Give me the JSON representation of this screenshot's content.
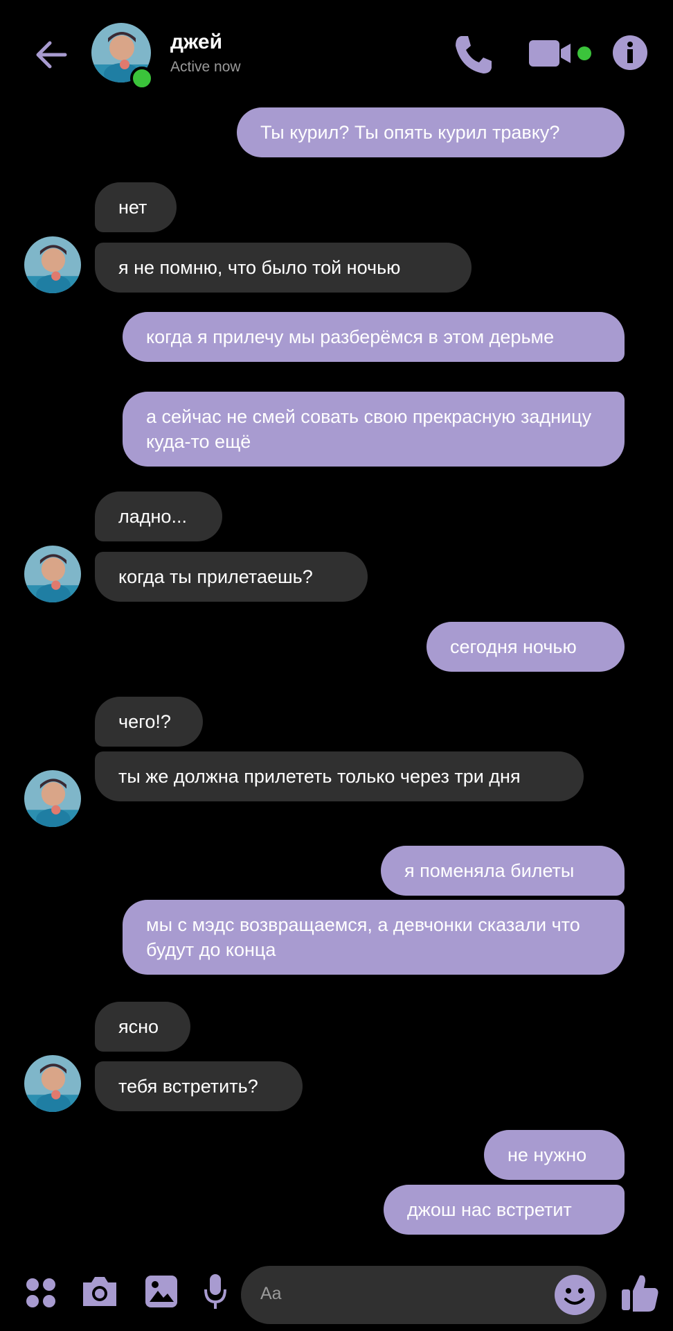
{
  "header": {
    "name": "джей",
    "status": "Active now"
  },
  "colors": {
    "accent": "#a89bd0",
    "incoming_bubble": "#303030",
    "online": "#3bc33b",
    "background": "#000000"
  },
  "messages": [
    {
      "side": "out",
      "text": "Ты курил? Ты опять курил травку?"
    },
    {
      "side": "in",
      "text": "нет"
    },
    {
      "side": "in",
      "text": "я не помню, что было той ночью"
    },
    {
      "side": "out",
      "text": "когда я прилечу мы разберёмся в этом дерьме"
    },
    {
      "side": "out",
      "text": "а сейчас не смей совать свою прекрасную задницу куда-то ещё"
    },
    {
      "side": "in",
      "text": "ладно..."
    },
    {
      "side": "in",
      "text": "когда ты прилетаешь?"
    },
    {
      "side": "out",
      "text": "сегодня ночью"
    },
    {
      "side": "in",
      "text": "чего!?"
    },
    {
      "side": "in",
      "text": "ты же должна прилететь только через три дня"
    },
    {
      "side": "out",
      "text": "я поменяла билеты"
    },
    {
      "side": "out",
      "text": "мы с мэдс возвращаемся,  а девчонки сказали что будут до конца"
    },
    {
      "side": "in",
      "text": "ясно"
    },
    {
      "side": "in",
      "text": "тебя встретить?"
    },
    {
      "side": "out",
      "text": "не нужно"
    },
    {
      "side": "out",
      "text": "джош нас встретит"
    }
  ],
  "composer": {
    "placeholder": "Aa",
    "icons": [
      "apps-icon",
      "camera-icon",
      "gallery-icon",
      "microphone-icon",
      "emoji-icon",
      "thumbs-up-icon"
    ]
  }
}
